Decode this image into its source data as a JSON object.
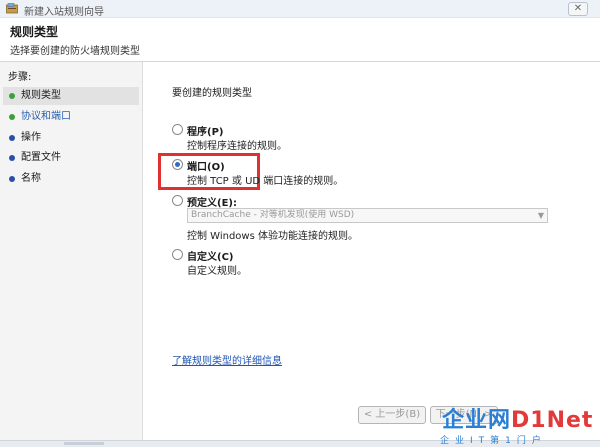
{
  "window": {
    "title": "新建入站规则向导",
    "close_glyph": "✕",
    "icon": "wizard-icon"
  },
  "header": {
    "title": "规则类型",
    "subtitle": "选择要创建的防火墙规则类型"
  },
  "steps": {
    "title": "步骤:",
    "items": [
      {
        "label": "规则类型",
        "status": "active",
        "dot_color": "#3aa13a"
      },
      {
        "label": "协议和端口",
        "status": "current",
        "dot_color": "#3aa13a"
      },
      {
        "label": "操作",
        "status": "pending",
        "dot_color": "#2a4fa8"
      },
      {
        "label": "配置文件",
        "status": "pending",
        "dot_color": "#2a4fa8"
      },
      {
        "label": "名称",
        "status": "pending",
        "dot_color": "#2a4fa8"
      }
    ]
  },
  "main": {
    "prompt": "要创建的规则类型",
    "options": [
      {
        "label": "程序(P)",
        "description": "控制程序连接的规则。",
        "checked": false
      },
      {
        "label": "端口(O)",
        "description": "控制 TCP 或 UD 端口连接的规则。",
        "checked": true
      },
      {
        "label": "预定义(E):",
        "description": "控制 Windows 体验功能连接的规则。",
        "checked": false
      },
      {
        "label": "自定义(C)",
        "description": "自定义规则。",
        "checked": false
      }
    ],
    "predefined_select": {
      "value": "BranchCache - 对等机发现(使用 WSD)",
      "enabled": false
    },
    "learn_more_link": "了解规则类型的详细信息"
  },
  "buttons": {
    "back": "< 上一步(B)",
    "next": "下一步(N) >"
  },
  "watermark": {
    "logo": "企业网",
    "logo_accent": "D1Net",
    "tagline": "企业IT第1门户"
  },
  "colors": {
    "highlight_box": "#e03030",
    "link": "#1f55b4",
    "selected_radio": "#2f6bc4"
  }
}
